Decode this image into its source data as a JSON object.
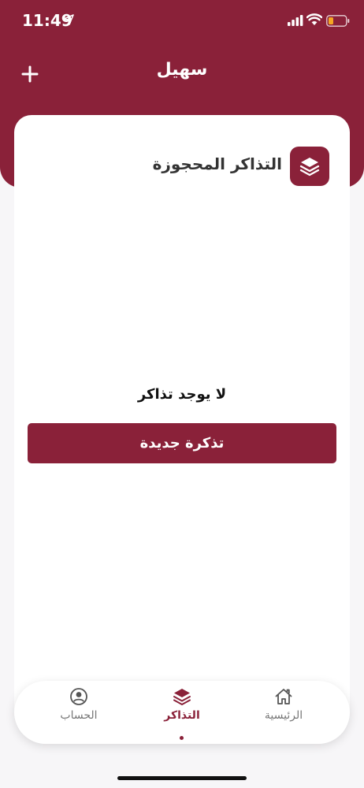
{
  "status_bar": {
    "time": "11:49",
    "icons": [
      "location-arrow-icon",
      "cellular-signal-icon",
      "wifi-icon",
      "battery-low-icon"
    ]
  },
  "header": {
    "title": "سهيل",
    "add_icon": "plus-icon"
  },
  "booked_tickets": {
    "title": "التذاكر المحجوزة",
    "icon": "layers-icon",
    "empty_message": "لا يوجد تذاكر",
    "new_ticket_label": "تذكرة جديدة"
  },
  "bottom_nav": {
    "items": [
      {
        "label": "الحساب",
        "icon": "user-circle-icon",
        "active": false
      },
      {
        "label": "التذاكر",
        "icon": "layers-icon",
        "active": true
      },
      {
        "label": "الرئيسية",
        "icon": "home-icon",
        "active": false
      }
    ]
  },
  "colors": {
    "brand": "#8a2139",
    "background": "#f7f6f8",
    "battery_warning": "#f5a623"
  }
}
